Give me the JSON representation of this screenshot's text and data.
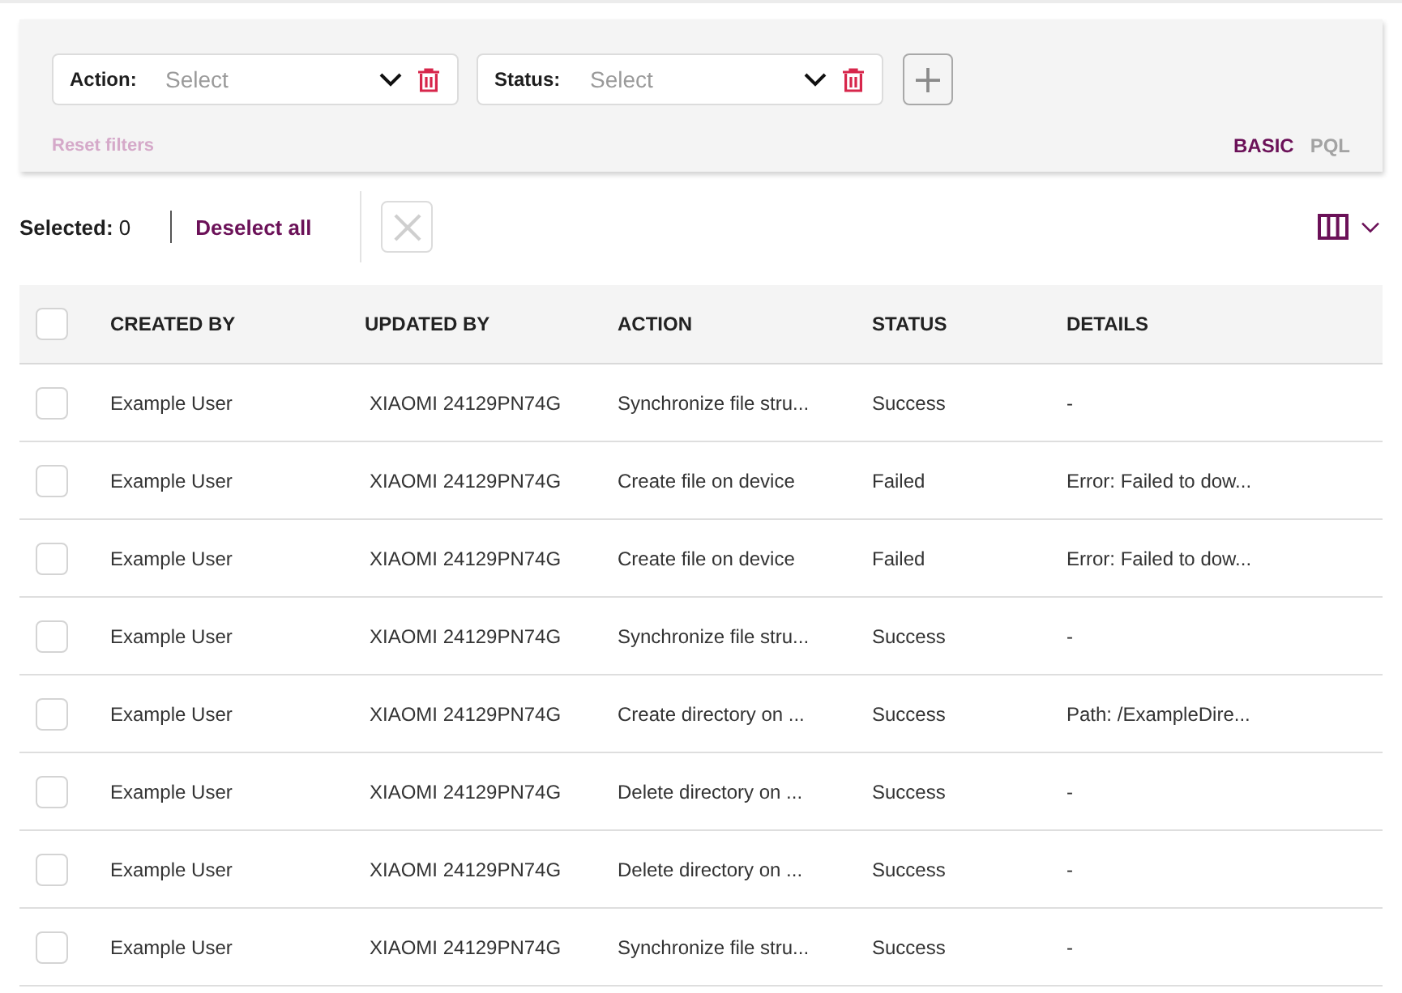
{
  "filters": {
    "items": [
      {
        "label": "Action:",
        "placeholder": "Select"
      },
      {
        "label": "Status:",
        "placeholder": "Select"
      }
    ],
    "reset": {
      "label": "Reset filters",
      "disabled": true
    },
    "modes": [
      {
        "label": "BASIC",
        "selected": true
      },
      {
        "label": "PQL",
        "selected": false
      }
    ]
  },
  "selection": {
    "text": "**Selected:** 0",
    "deselect": "Deselect all",
    "clear_disabled": true
  },
  "table": {
    "header_checked": false,
    "columns": [
      "CREATED BY",
      "UPDATED BY",
      "ACTION",
      "STATUS",
      "DETAILS"
    ],
    "rows": [
      {
        "checked": false,
        "cells": [
          "Example User",
          "XIAOMI 24129PN74G",
          "Synchronize file stru...",
          "Success",
          "-"
        ]
      },
      {
        "checked": false,
        "cells": [
          "Example User",
          "XIAOMI 24129PN74G",
          "Create file on device",
          "Failed",
          "Error: Failed to dow..."
        ]
      },
      {
        "checked": false,
        "cells": [
          "Example User",
          "XIAOMI 24129PN74G",
          "Create file on device",
          "Failed",
          "Error: Failed to dow..."
        ]
      },
      {
        "checked": false,
        "cells": [
          "Example User",
          "XIAOMI 24129PN74G",
          "Synchronize file stru...",
          "Success",
          "-"
        ]
      },
      {
        "checked": false,
        "cells": [
          "Example User",
          "XIAOMI 24129PN74G",
          "Create directory on ...",
          "Success",
          "Path: /ExampleDire..."
        ]
      },
      {
        "checked": false,
        "cells": [
          "Example User",
          "XIAOMI 24129PN74G",
          "Delete directory on ...",
          "Success",
          "-"
        ]
      },
      {
        "checked": false,
        "cells": [
          "Example User",
          "XIAOMI 24129PN74G",
          "Delete directory on ...",
          "Success",
          "-"
        ]
      },
      {
        "checked": false,
        "cells": [
          "Example User",
          "XIAOMI 24129PN74G",
          "Synchronize file stru...",
          "Success",
          "-"
        ]
      }
    ]
  }
}
